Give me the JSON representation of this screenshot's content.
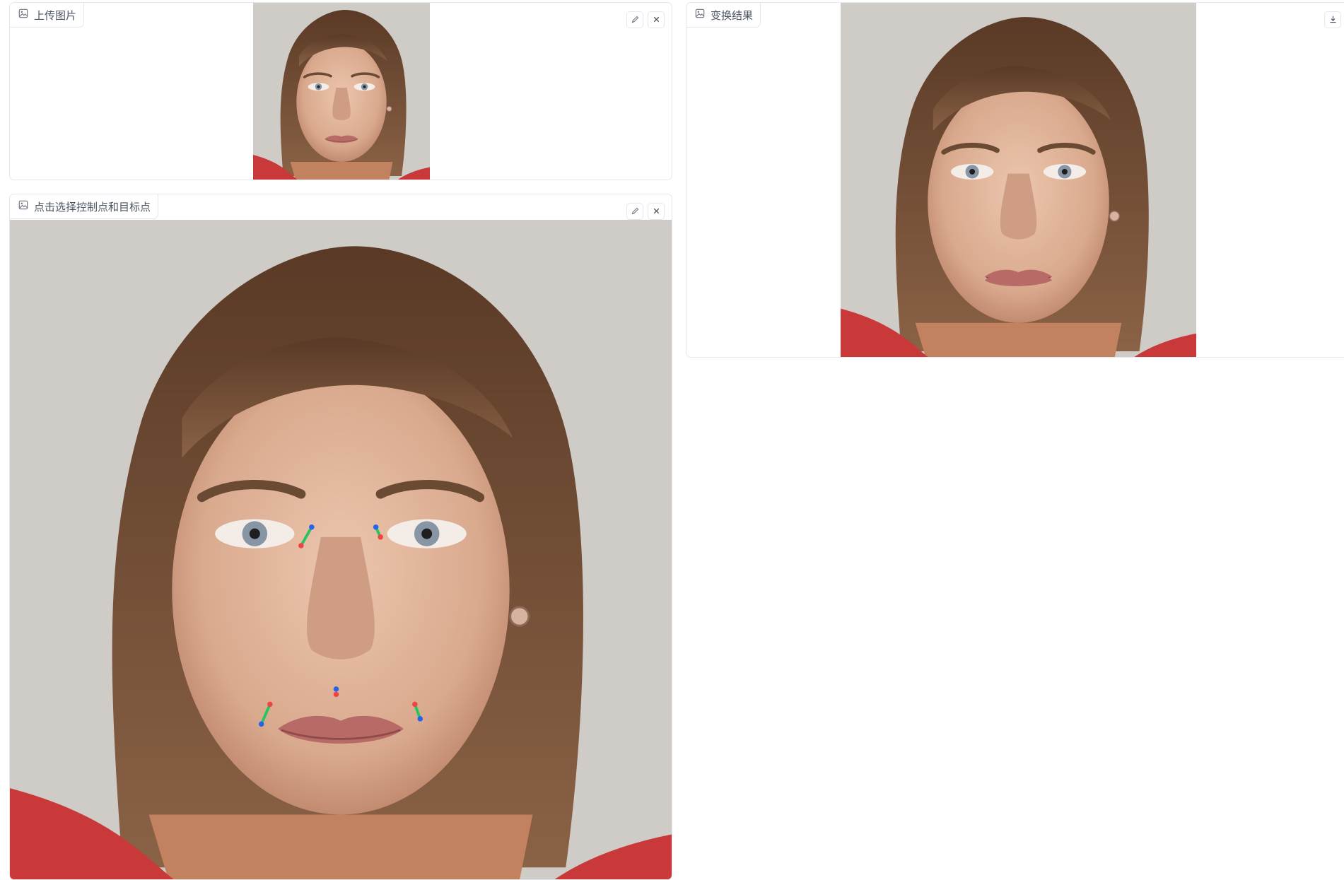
{
  "upload_panel": {
    "label": "上传图片",
    "label_icon": "image-icon",
    "edit_icon": "pencil-icon",
    "clear_icon": "close-icon"
  },
  "points_panel": {
    "label": "点击选择控制点和目标点",
    "label_icon": "image-icon",
    "edit_icon": "pencil-icon",
    "clear_icon": "close-icon",
    "marker_colors": {
      "control_point": "#ef4444",
      "target_point": "#2563eb",
      "arrow": "#22c55e"
    }
  },
  "result_panel": {
    "label": "变换结果",
    "label_icon": "image-icon",
    "download_icon": "download-icon"
  }
}
